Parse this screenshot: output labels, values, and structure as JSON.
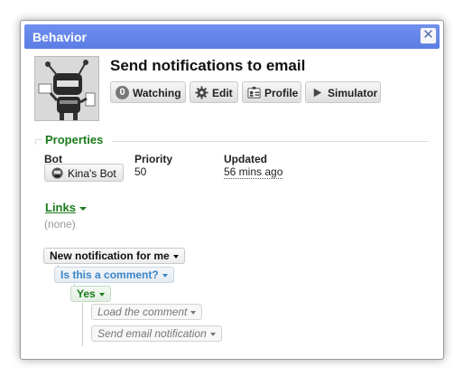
{
  "dialog": {
    "title": "Behavior",
    "close_icon": "close-icon"
  },
  "header": {
    "heading": "Send notifications to email",
    "avatar_icon": "robot-icon"
  },
  "toolbar": {
    "watching_count": "0",
    "watching_label": "Watching",
    "edit_label": "Edit",
    "profile_label": "Profile",
    "simulator_label": "Simulator"
  },
  "properties": {
    "title": "Properties",
    "bot_header": "Bot",
    "bot_value": "Kina's Bot",
    "priority_header": "Priority",
    "priority_value": "50",
    "updated_header": "Updated",
    "updated_value": "56 mins ago"
  },
  "links": {
    "title": "Links",
    "empty_text": "(none)"
  },
  "rules": {
    "trigger": "New notification for me",
    "condition": "Is this a comment?",
    "branch": "Yes",
    "action_1": "Load the comment",
    "action_2": "Send email notification"
  },
  "colors": {
    "titlebar": "#5b7de3",
    "section_green": "#1b7a1b",
    "condition_blue": "#3b86c8"
  }
}
